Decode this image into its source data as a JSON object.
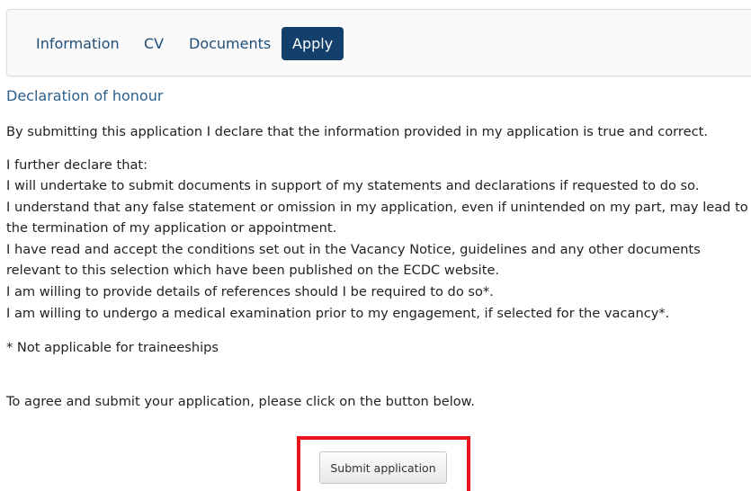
{
  "tabs": [
    {
      "label": "Information",
      "active": false
    },
    {
      "label": "CV",
      "active": false
    },
    {
      "label": "Documents",
      "active": false
    },
    {
      "label": "Apply",
      "active": true
    }
  ],
  "section_title": "Declaration of honour",
  "intro": "By submitting this application I declare that the information provided in my application is true and correct.",
  "further": "I further declare that:",
  "declarations": [
    "I will undertake to submit documents in support of my statements and declarations if requested to do so.",
    "I understand that any false statement or omission in my application, even if unintended on my part, may lead to",
    "the termination of my application or appointment.",
    "I have read and accept the conditions set out in the Vacancy Notice, guidelines and any other documents",
    "relevant to this selection which have been published on the ECDC website.",
    "I am willing to provide details of references should I be required to do so*.",
    "I am willing to undergo a medical examination prior to my engagement, if selected for the vacancy*."
  ],
  "footnote": "* Not applicable for traineeships",
  "instruction": "To agree and submit your application, please click on the button below.",
  "submit_label": "Submit application",
  "colors": {
    "tab_active_bg": "#13406b",
    "tab_text": "#1f4e79",
    "highlight": "#e8141c"
  }
}
